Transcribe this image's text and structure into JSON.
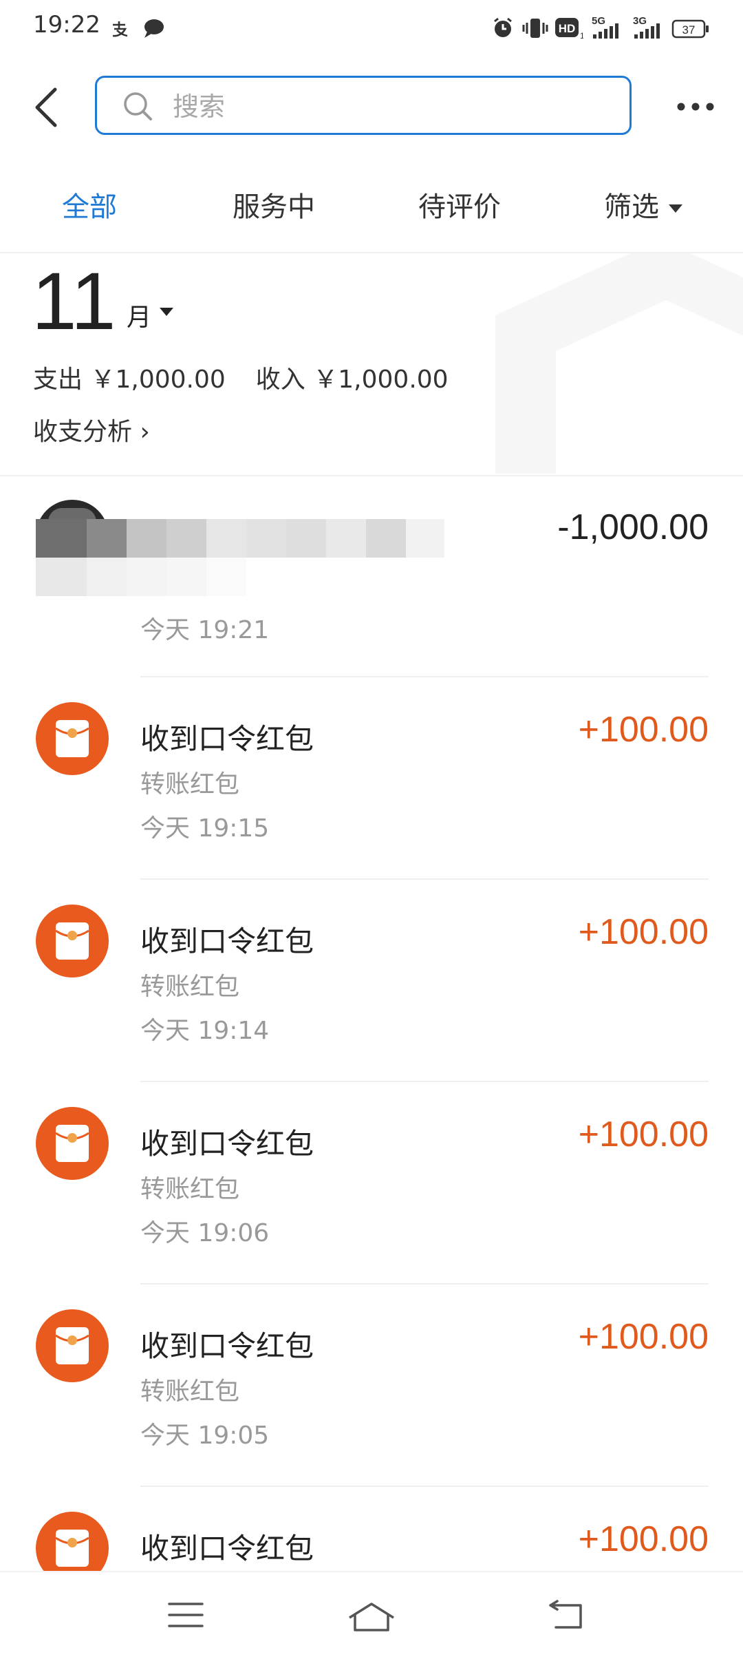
{
  "status_bar": {
    "time": "19:22",
    "icons": [
      "alipay-icon",
      "chat-icon",
      "alarm-icon",
      "vibrate-icon",
      "hd-icon",
      "signal-5g-icon",
      "signal-3g-icon",
      "battery-icon"
    ],
    "battery_level": "37",
    "net_5g": "5G",
    "net_3g": "3G",
    "hd": "HD"
  },
  "header": {
    "search_placeholder": "搜索"
  },
  "tabs": [
    {
      "label": "全部",
      "active": true
    },
    {
      "label": "服务中",
      "active": false
    },
    {
      "label": "待评价",
      "active": false
    }
  ],
  "filter": {
    "label": "筛选"
  },
  "summary": {
    "month_number": "11",
    "month_unit": "月",
    "expense_label": "支出",
    "expense_value": "￥1,000.00",
    "income_label": "收入",
    "income_value": "￥1,000.00",
    "analysis_label": "收支分析 ›"
  },
  "transactions": [
    {
      "title": "",
      "subtitle": "",
      "time": "今天  19:21",
      "amount": "-1,000.00",
      "type": "minus"
    },
    {
      "title": "收到口令红包",
      "subtitle": "转账红包",
      "time": "今天  19:15",
      "amount": "+100.00",
      "type": "plus"
    },
    {
      "title": "收到口令红包",
      "subtitle": "转账红包",
      "time": "今天  19:14",
      "amount": "+100.00",
      "type": "plus"
    },
    {
      "title": "收到口令红包",
      "subtitle": "转账红包",
      "time": "今天  19:06",
      "amount": "+100.00",
      "type": "plus"
    },
    {
      "title": "收到口令红包",
      "subtitle": "转账红包",
      "time": "今天  19:05",
      "amount": "+100.00",
      "type": "plus"
    },
    {
      "title": "收到口令红包",
      "subtitle": "",
      "time": "",
      "amount": "+100.00",
      "type": "plus"
    }
  ],
  "colors": {
    "accent": "#1f7ad6",
    "income": "#e05a1d",
    "redpacket": "#e95a1e"
  },
  "nav": [
    "menu-icon",
    "home-icon",
    "back-nav-icon"
  ]
}
